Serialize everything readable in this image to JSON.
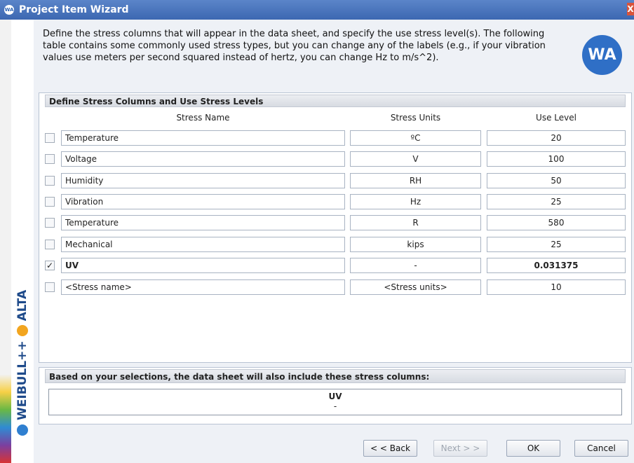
{
  "window": {
    "title": "Project Item Wizard",
    "app_icon": "WA",
    "close_glyph": "X"
  },
  "sidebar": {
    "brand_first": "WEIBULL++",
    "brand_second": "ALTA"
  },
  "description": "Define the stress columns that will appear in the data sheet, and specify the use stress level(s). The following table contains some commonly used stress types, but you can change any of the labels (e.g., if your vibration values use meters per second squared instead of hertz, you can change Hz to m/s^2).",
  "logo_text": "WA",
  "stress_panel": {
    "header": "Define Stress Columns and Use Stress Levels",
    "columns": {
      "name": "Stress Name",
      "units": "Stress Units",
      "use": "Use Level"
    },
    "rows": [
      {
        "checked": false,
        "name": "Temperature",
        "units": "ºC",
        "use": "20"
      },
      {
        "checked": false,
        "name": "Voltage",
        "units": "V",
        "use": "100"
      },
      {
        "checked": false,
        "name": "Humidity",
        "units": "RH",
        "use": "50"
      },
      {
        "checked": false,
        "name": "Vibration",
        "units": "Hz",
        "use": "25"
      },
      {
        "checked": false,
        "name": "Temperature",
        "units": "R",
        "use": "580"
      },
      {
        "checked": false,
        "name": "Mechanical",
        "units": "kips",
        "use": "25"
      },
      {
        "checked": true,
        "name": "UV",
        "units": "-",
        "use": "0.031375"
      },
      {
        "checked": false,
        "name": "<Stress name>",
        "units": "<Stress units>",
        "use": "10"
      }
    ]
  },
  "summary_panel": {
    "header": "Based on your selections, the data sheet will also include these stress columns:",
    "column_name": "UV",
    "column_units": "-"
  },
  "buttons": {
    "back": "< < Back",
    "next": "Next > >",
    "ok": "OK",
    "cancel": "Cancel"
  },
  "check_glyph": "✓",
  "colors": {
    "title_bar": "#3c67b1",
    "logo": "#2f6fc6",
    "close": "#d9533b"
  }
}
